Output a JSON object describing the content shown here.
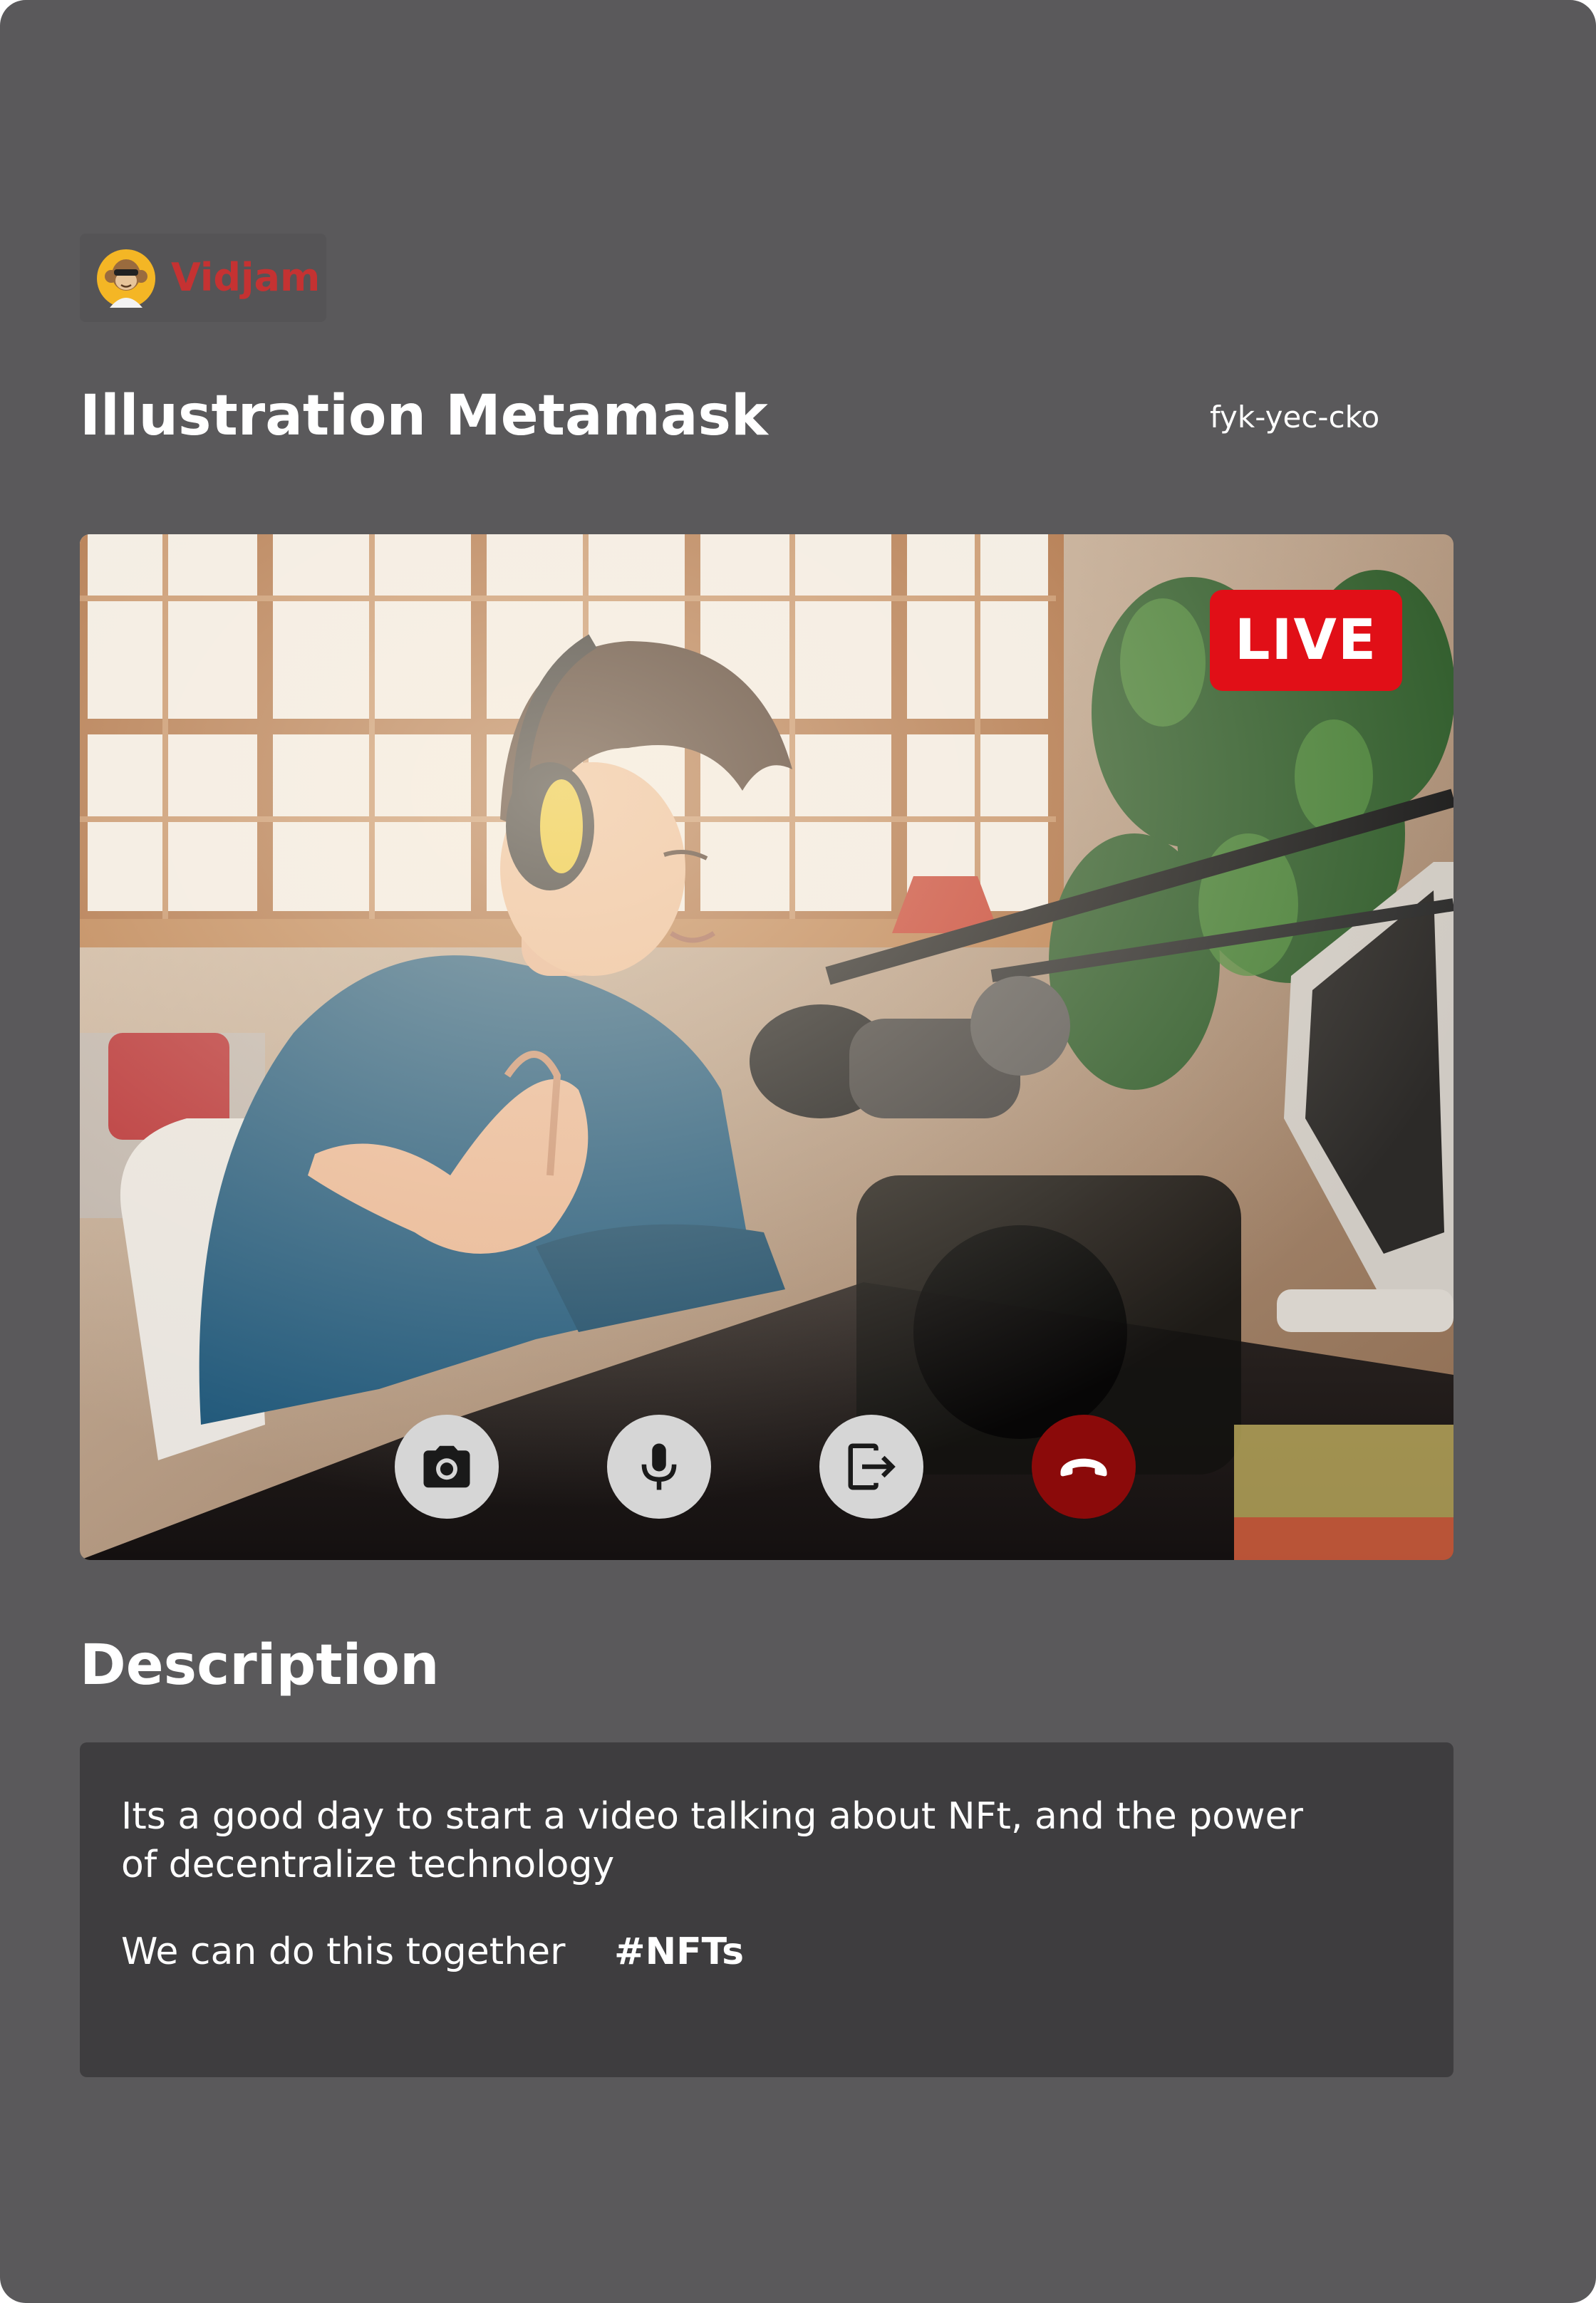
{
  "brand": {
    "name": "Vidjam",
    "logo_icon": "monkey-avatar-icon",
    "color": "#c53232"
  },
  "stream": {
    "title": "Illustration Metamask",
    "room_code": "fyk-yec-cko",
    "live_label": "LIVE",
    "live_color": "#e10f17"
  },
  "controls": [
    {
      "name": "camera-button",
      "icon": "camera-icon"
    },
    {
      "name": "microphone-button",
      "icon": "microphone-icon"
    },
    {
      "name": "share-screen-button",
      "icon": "exit-arrow-icon"
    },
    {
      "name": "end-call-button",
      "icon": "phone-hangup-icon",
      "color": "#8b0a0a"
    }
  ],
  "description": {
    "heading": "Description",
    "text": "Its a good day to start a video talking about NFt, and the power of decentralize technology",
    "closing": "We can do this together",
    "hashtag": "#NFTs"
  }
}
